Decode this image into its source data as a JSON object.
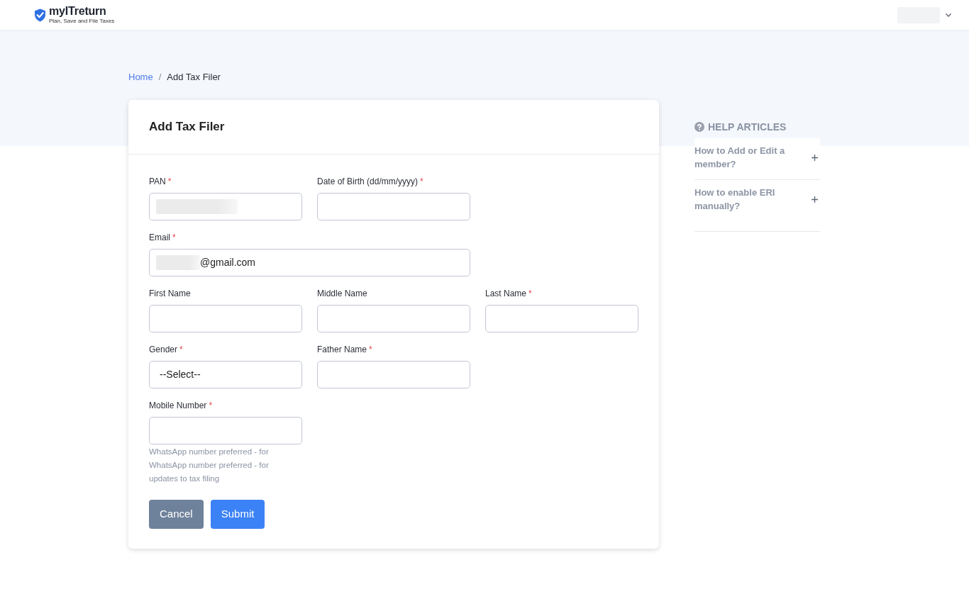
{
  "header": {
    "logo": {
      "name": "myITreturn",
      "tagline": "Plan, Save and File Taxes"
    },
    "user_menu": {
      "redacted": true
    }
  },
  "breadcrumb": {
    "separator": "/",
    "items": [
      {
        "label": "Home",
        "kind": "link"
      },
      {
        "label": "Add Tax Filer",
        "kind": "current"
      }
    ]
  },
  "form": {
    "title": "Add Tax Filer",
    "rows": [
      [
        {
          "label": "PAN",
          "required_mark": "*",
          "kind": "text",
          "redacted": true,
          "wide": false
        },
        {
          "label": "Date of Birth (dd/mm/yyyy)",
          "required_mark": "*",
          "kind": "text",
          "redacted": false,
          "wide": false
        }
      ],
      [
        {
          "label": "Email",
          "required_mark": "*",
          "kind": "text",
          "value": "@gmail.com",
          "redacted": true,
          "wide": true
        }
      ],
      [
        {
          "label": "First Name",
          "kind": "text",
          "redacted": false,
          "wide": false
        },
        {
          "label": "Middle Name",
          "kind": "text",
          "redacted": false,
          "wide": false
        },
        {
          "label": "Last Name",
          "required_mark": "*",
          "kind": "text",
          "redacted": false,
          "wide": false
        }
      ],
      [
        {
          "label": "Gender",
          "required_mark": "*",
          "kind": "select",
          "value": "--Select--",
          "redacted": false,
          "wide": false
        },
        {
          "label": "Father Name",
          "required_mark": "*",
          "kind": "text",
          "redacted": false,
          "wide": false
        }
      ],
      [
        {
          "label": "Mobile Number",
          "required_mark": "*",
          "kind": "text",
          "redacted": false,
          "wide": false,
          "help": [
            "WhatsApp number preferred - for",
            "WhatsApp number preferred - for updates to tax filing"
          ]
        }
      ]
    ],
    "buttons": [
      {
        "label": "Cancel",
        "kind": "secondary"
      },
      {
        "label": "Submit",
        "kind": "primary"
      }
    ]
  },
  "help_articles": {
    "title": "HELP ARTICLES",
    "items": [
      {
        "title": "How to Add or Edit a member?",
        "expanded": false
      },
      {
        "title": "How to enable ERI manually?",
        "expanded": false
      }
    ]
  }
}
